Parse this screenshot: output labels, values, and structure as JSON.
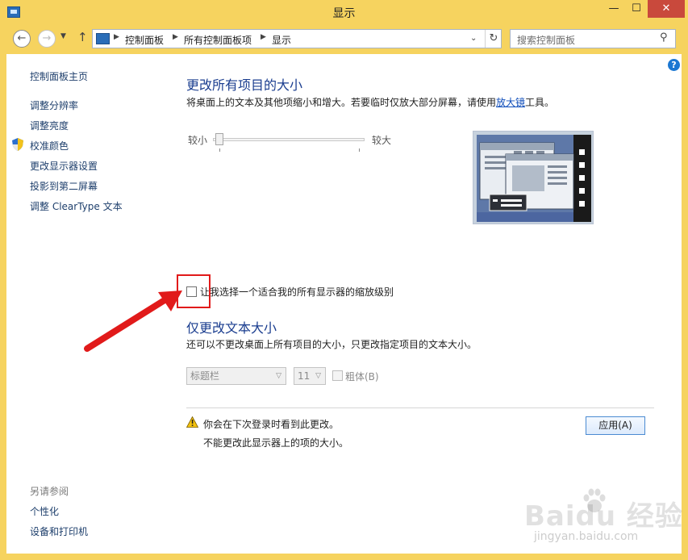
{
  "window": {
    "title": "显示",
    "controls": {
      "minimize": "—",
      "maximize": "☐",
      "close": "✕"
    }
  },
  "nav": {
    "breadcrumbs": [
      "控制面板",
      "所有控制面板项",
      "显示"
    ],
    "search_placeholder": "搜索控制面板"
  },
  "sidebar": {
    "home": "控制面板主页",
    "links": [
      "调整分辨率",
      "调整亮度",
      "校准颜色",
      "更改显示器设置",
      "投影到第二屏幕",
      "调整 ClearType 文本"
    ],
    "see_also_title": "另请参阅",
    "see_also": [
      "个性化",
      "设备和打印机"
    ]
  },
  "main": {
    "section1": {
      "title": "更改所有项目的大小",
      "desc_before": "将桌面上的文本及其他项缩小和增大。若要临时仅放大部分屏幕，请使用",
      "desc_link": "放大镜",
      "desc_after": "工具。"
    },
    "slider": {
      "min_label": "较小",
      "max_label": "较大",
      "level": 0
    },
    "checkbox_label": "让我选择一个适合我的所有显示器的缩放级别",
    "checkbox_checked": false,
    "section2": {
      "title": "仅更改文本大小",
      "desc": "还可以不更改桌面上所有项目的大小，只更改指定项目的文本大小。"
    },
    "item_select": "标题栏",
    "size_select": "11",
    "bold_label": "粗体(B)",
    "warning_lines": [
      "你会在下次登录时看到此更改。",
      "不能更改此显示器上的项的大小。"
    ],
    "apply_label": "应用(A)"
  },
  "watermark": {
    "brand": "Baidu 经验",
    "url": "jingyan.baidu.com"
  },
  "colors": {
    "frame": "#f6d35f",
    "accent_blue": "#1a3d8f",
    "annotation_red": "#e11a1a"
  }
}
